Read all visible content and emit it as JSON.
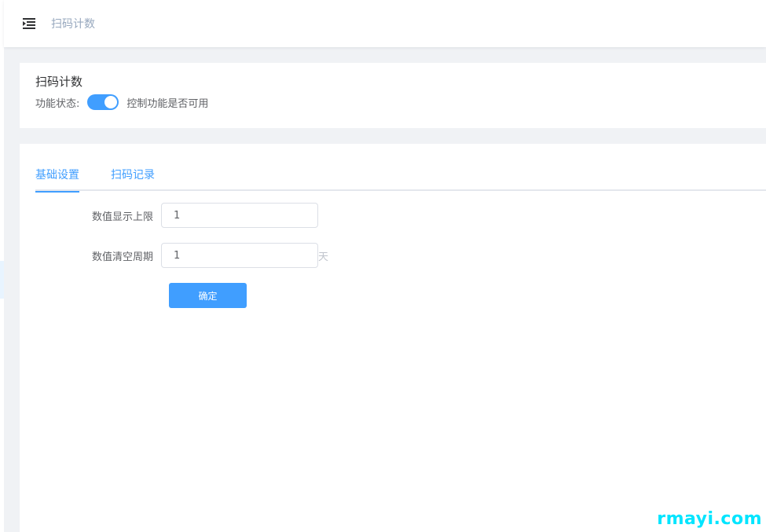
{
  "header": {
    "menu_icon": "menu-fold-icon",
    "breadcrumb": "扫码计数"
  },
  "status": {
    "title": "扫码计数",
    "label": "功能状态:",
    "enabled": true,
    "description": "控制功能是否可用"
  },
  "tabs": [
    {
      "label": "基础设置",
      "active": true
    },
    {
      "label": "扫码记录",
      "active": false
    }
  ],
  "form": {
    "display_limit": {
      "label": "数值显示上限",
      "value": "1"
    },
    "clear_period": {
      "label": "数值清空周期",
      "value": "1",
      "suffix": "天"
    },
    "submit_label": "确定"
  },
  "watermark": "rmayi.com",
  "colors": {
    "primary": "#409eff",
    "background": "#f0f2f5",
    "watermark": "#00e5ff"
  }
}
